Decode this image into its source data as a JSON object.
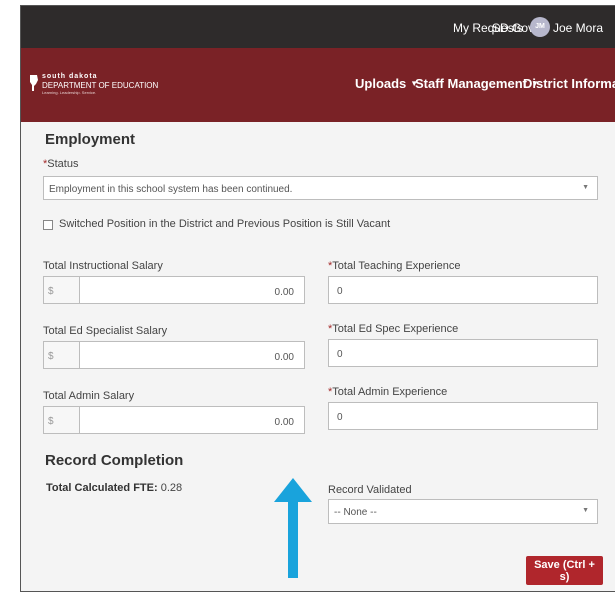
{
  "topbar": {
    "my_requests": "My Requests",
    "sd_gov": "SD.Gov",
    "avatar_initials": "JM",
    "user_name": "Joe Mora"
  },
  "navbar": {
    "logo_line1": "south dakota",
    "logo_line2": "DEPARTMENT OF EDUCATION",
    "logo_line3": "Learning. Leadership. Service.",
    "items": [
      {
        "label": "Uploads"
      },
      {
        "label": "Staff Management"
      },
      {
        "label": "District Information"
      }
    ]
  },
  "employment": {
    "heading": "Employment",
    "status_label": "Status",
    "status_value": "Employment in this school system has been continued.",
    "switched_label": "Switched Position in the District and Previous Position is Still Vacant"
  },
  "salaries": {
    "currency_prefix": "$",
    "instructional_label": "Total Instructional Salary",
    "instructional_value": "0.00",
    "ed_specialist_label": "Total Ed Specialist Salary",
    "ed_specialist_value": "0.00",
    "admin_label": "Total Admin Salary",
    "admin_value": "0.00"
  },
  "experience": {
    "teaching_label": "Total Teaching Experience",
    "teaching_value": "0",
    "ed_spec_label": "Total Ed Spec Experience",
    "ed_spec_value": "0",
    "admin_label": "Total Admin Experience",
    "admin_value": "0"
  },
  "record_completion": {
    "heading": "Record Completion",
    "fte_label": "Total Calculated FTE:",
    "fte_value": "0.28",
    "validated_label": "Record Validated",
    "validated_value": "-- None --"
  },
  "save_button": "Save (Ctrl + s)",
  "colors": {
    "topbar": "#2e2b2b",
    "brand": "#7a2226",
    "save": "#b0262c",
    "arrow": "#19a3dc"
  }
}
